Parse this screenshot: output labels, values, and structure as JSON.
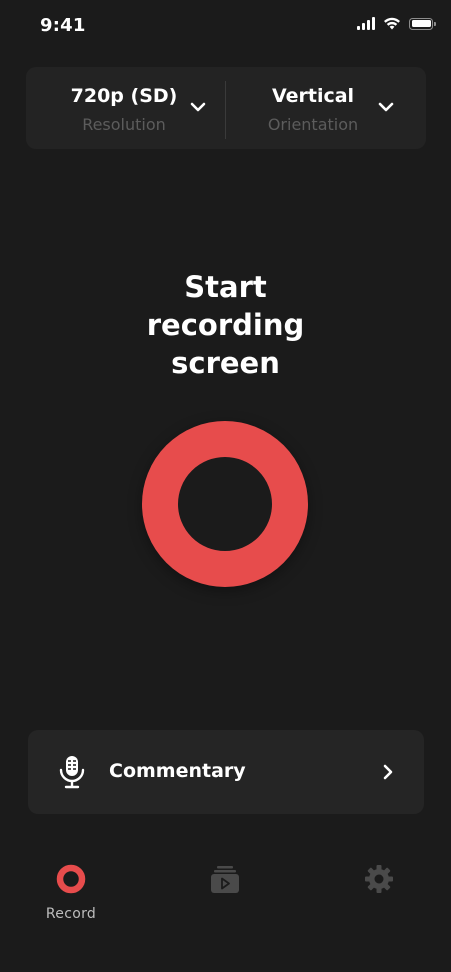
{
  "status_bar": {
    "time": "9:41",
    "icons": [
      "signal-icon",
      "wifi-icon",
      "battery-icon"
    ]
  },
  "settings": {
    "resolution": {
      "value": "720p (SD)",
      "label": "Resolution"
    },
    "orientation": {
      "value": "Vertical",
      "label": "Orientation"
    }
  },
  "main": {
    "title": "Start recording screen"
  },
  "commentary": {
    "label": "Commentary"
  },
  "tab_bar": {
    "tabs": [
      {
        "label": "Record",
        "icon": "record-icon",
        "active": true
      },
      {
        "label": "",
        "icon": "gallery-icon",
        "active": false
      },
      {
        "label": "",
        "icon": "gear-icon",
        "active": false
      }
    ]
  },
  "colors": {
    "background": "#1b1b1b",
    "card": "#232323",
    "accent": "#e74c4c",
    "muted_text": "#5c5c5c",
    "inactive_icon": "#4a4a4a"
  }
}
